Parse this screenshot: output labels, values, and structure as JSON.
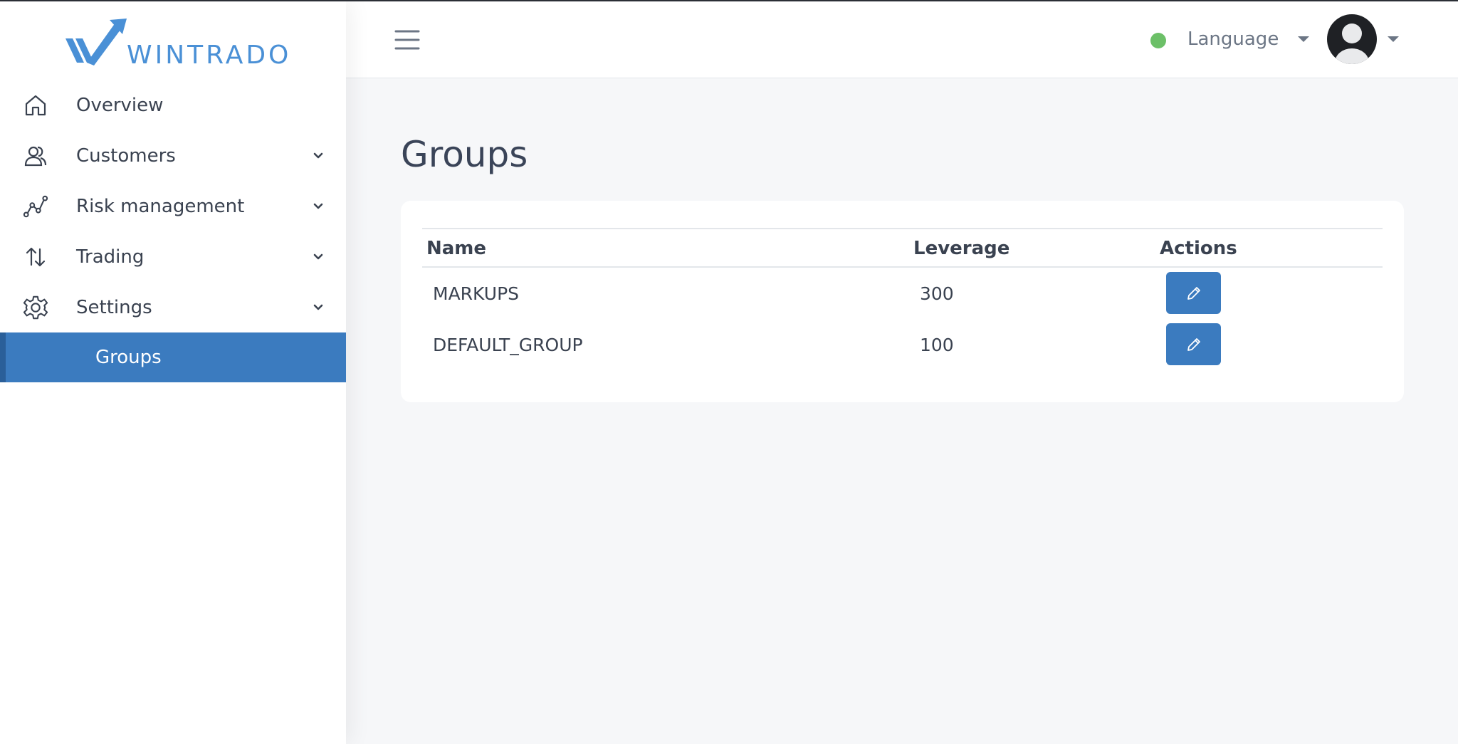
{
  "brand": {
    "name": "WINTRADO",
    "accent": "#4a90d6"
  },
  "sidebar": {
    "items": [
      {
        "label": "Overview",
        "icon": "home-icon",
        "has_submenu": false
      },
      {
        "label": "Customers",
        "icon": "users-icon",
        "has_submenu": true
      },
      {
        "label": "Risk management",
        "icon": "chart-line-icon",
        "has_submenu": true
      },
      {
        "label": "Trading",
        "icon": "arrows-up-down-icon",
        "has_submenu": true
      },
      {
        "label": "Settings",
        "icon": "gear-icon",
        "has_submenu": true
      }
    ],
    "active_subitem": {
      "label": "Groups",
      "color": "#3b7bbf"
    }
  },
  "topbar": {
    "menu_icon": "hamburger-icon",
    "status": {
      "color": "#6cc068"
    },
    "language_label": "Language",
    "avatar_icon": "user-avatar-icon"
  },
  "main": {
    "title": "Groups",
    "table": {
      "columns": [
        "Name",
        "Leverage",
        "Actions"
      ],
      "rows": [
        {
          "name": "MARKUPS",
          "leverage": "300",
          "action_icon": "pencil-icon"
        },
        {
          "name": "DEFAULT_GROUP",
          "leverage": "100",
          "action_icon": "pencil-icon"
        }
      ]
    }
  }
}
